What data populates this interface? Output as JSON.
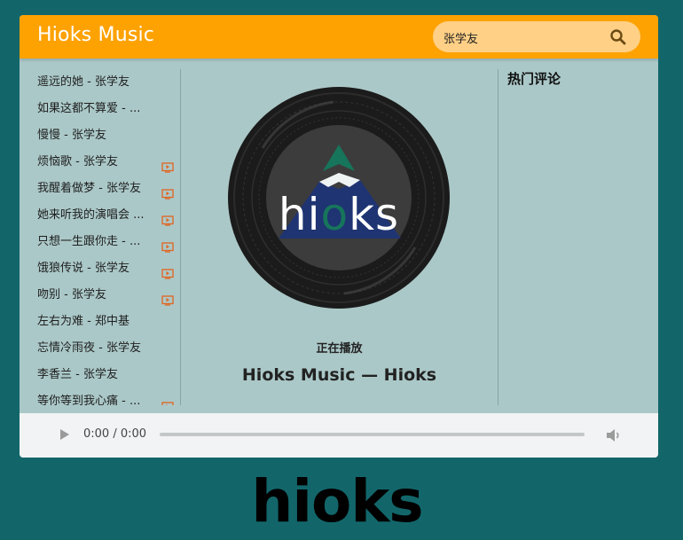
{
  "header": {
    "title": "Hioks Music"
  },
  "search": {
    "value": "张学友",
    "icon": "search-icon"
  },
  "playlist": [
    {
      "label": "遥远的她 - 张学友",
      "mv": false
    },
    {
      "label": "如果这都不算爱 - ...",
      "mv": false
    },
    {
      "label": "慢慢 - 张学友",
      "mv": false
    },
    {
      "label": "烦恼歌 - 张学友",
      "mv": true
    },
    {
      "label": "我醒着做梦 - 张学友",
      "mv": true
    },
    {
      "label": "她来听我的演唱会 ...",
      "mv": true
    },
    {
      "label": "只想一生跟你走 - ...",
      "mv": true
    },
    {
      "label": "饿狼传说 - 张学友",
      "mv": true
    },
    {
      "label": "吻别 - 张学友",
      "mv": true
    },
    {
      "label": "左右为难 - 郑中基",
      "mv": false
    },
    {
      "label": "忘情冷雨夜 - 张学友",
      "mv": false
    },
    {
      "label": "李香兰 - 张学友",
      "mv": false
    },
    {
      "label": "等你等到我心痛 - ...",
      "mv": true
    }
  ],
  "player": {
    "now_playing_label": "正在播放",
    "track_title": "Hioks Music — Hioks",
    "disc_logo_text": "hioks"
  },
  "comments": {
    "title": "热门评论"
  },
  "audio": {
    "time": "0:00 / 0:00",
    "progress": 0
  },
  "footer": {
    "logo_text": "hioks"
  },
  "colors": {
    "header": "#fea202",
    "search_bg": "#ffd086",
    "panel_bg": "#abc8c8",
    "page_bg": "#12666a",
    "mv_icon": "#e2641f",
    "logo_green": "#16755b",
    "logo_navy": "#1f3472"
  }
}
